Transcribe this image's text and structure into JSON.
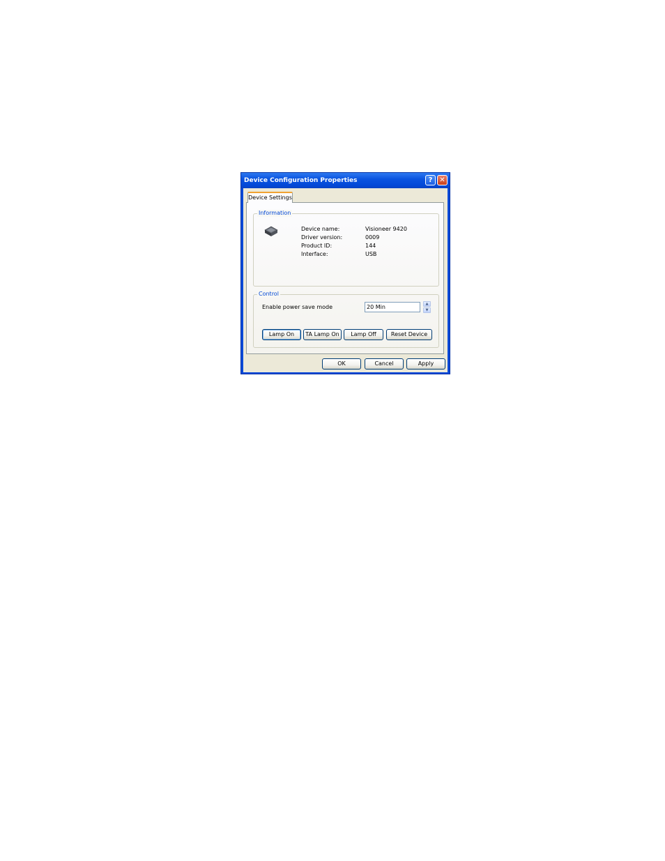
{
  "window": {
    "title": "Device Configuration Properties",
    "help_glyph": "?",
    "close_glyph": "✕"
  },
  "tabs": [
    {
      "label": "Device Settings",
      "selected": true
    }
  ],
  "information": {
    "legend": "Information",
    "icon": "scanner-icon",
    "rows": [
      {
        "label": "Device name:",
        "value": "Visioneer 9420"
      },
      {
        "label": "Driver version:",
        "value": "0009"
      },
      {
        "label": "Product ID:",
        "value": "144"
      },
      {
        "label": "Interface:",
        "value": "USB"
      }
    ]
  },
  "control": {
    "legend": "Control",
    "power_save_label": "Enable power save mode",
    "power_save_value": "20 Min",
    "buttons": {
      "lamp_on": "Lamp On",
      "ta_lamp_on": "TA Lamp On",
      "lamp_off": "Lamp Off",
      "reset_device": "Reset Device"
    }
  },
  "footer": {
    "ok": "OK",
    "cancel": "Cancel",
    "apply": "Apply"
  },
  "colors": {
    "title_bar": "#0a4ad8",
    "dialog_face": "#ece9d8",
    "group_legend": "#0046d5",
    "tab_highlight": "#f0a232",
    "close_button": "#c9411b"
  }
}
